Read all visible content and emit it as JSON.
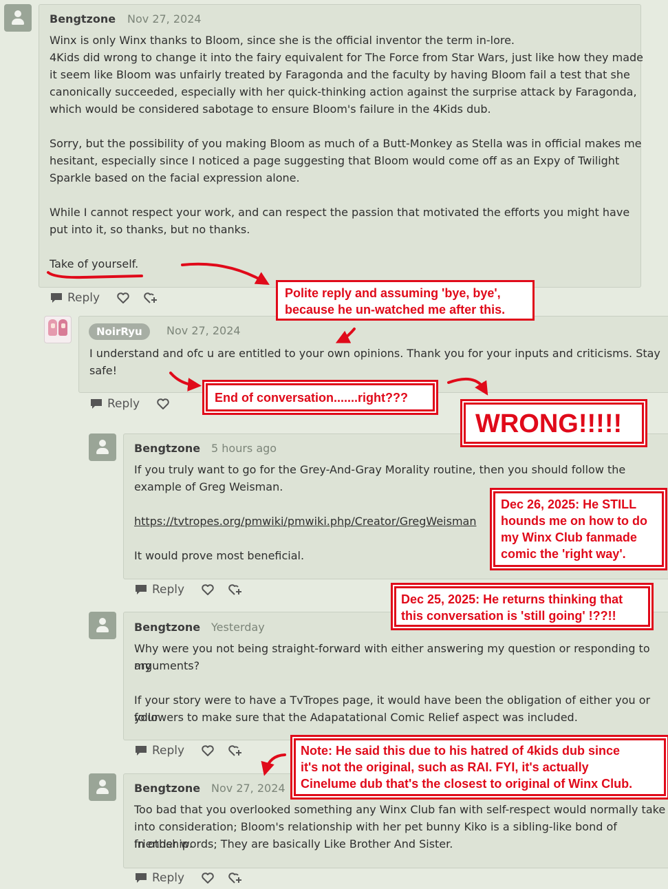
{
  "comments": [
    {
      "author": "Bengtzone",
      "date": "Nov 27, 2024",
      "lines": [
        "Winx is only Winx thanks to Bloom, since she is the official inventor the term in-lore.",
        "4Kids did wrong to change it into the fairy equivalent for The Force from Star Wars, just like how they made",
        "it seem like Bloom was unfairly treated by Faragonda and the faculty by having Bloom fail a test that she",
        "canonically succeeded,  especially with her quick-thinking action against the surprise attack by Faragonda,",
        "which would be considered sabotage to ensure Bloom's failure in the 4Kids dub.",
        "Sorry, but the possibility of you making Bloom as much of a Butt-Monkey as Stella was in official makes me",
        "hesitant, especially since I noticed a page suggesting that Bloom would come off as an Expy of Twilight",
        "Sparkle based on the facial expression alone.",
        "While I cannot respect your work, and can respect the passion that motivated the efforts you might have",
        "put into it, so thanks, but no thanks.",
        "Take of yourself."
      ],
      "reply_label": "Reply"
    },
    {
      "author": "NoirRyu",
      "date": "Nov 27, 2024",
      "lines": [
        "I understand and ofc u are entitled to your own opinions. Thank you for your inputs and criticisms. Stay",
        "safe!"
      ],
      "reply_label": "Reply"
    },
    {
      "author": "Bengtzone",
      "date": "5 hours ago",
      "lines": [
        "If you truly want to go for the Grey-And-Gray Morality routine, then you should follow the",
        "example of Greg Weisman.",
        "https://tvtropes.org/pmwiki/pmwiki.php/Creator/GregWeisman",
        "It would prove most beneficial."
      ],
      "reply_label": "Reply"
    },
    {
      "author": "Bengtzone",
      "date": "Yesterday",
      "lines": [
        "Why were you not being straight-forward with either answering my question or responding to my",
        "arguments?",
        "If your story were to have a TvTropes page, it would have been the obligation of either you or your",
        "followers to make sure that the Adapatational Comic Relief aspect was included."
      ],
      "reply_label": "Reply"
    },
    {
      "author": "Bengtzone",
      "date": "Nov 27, 2024",
      "lines": [
        "Too bad that you overlooked something any Winx Club fan with self-respect would normally take",
        "into consideration; Bloom's relationship with her pet bunny Kiko is a sibling-like bond of friendship.",
        "In other words; They are basically Like Brother And Sister."
      ],
      "reply_label": "Reply"
    }
  ],
  "annotations": {
    "polite": [
      "Polite reply and assuming 'bye, bye',",
      "because he un-watched me after this."
    ],
    "end": "End of conversation.......right???",
    "wrong": "WRONG!!!!!",
    "dec26": [
      "Dec 26, 2025: He STILL",
      "hounds me on how to do",
      "my Winx Club fanmade",
      "comic the 'right way'."
    ],
    "dec25": [
      "Dec 25, 2025: He returns thinking that",
      "this conversation is 'still going' !??!!"
    ],
    "note": [
      "Note: He said this due to his hatred of 4kids dub since",
      "it's not the original, such as RAI. FYI, it's actually",
      "Cinelume dub that's the closest to original of Winx Club."
    ]
  },
  "icons": {
    "reply": "speech-bubble-icon",
    "like": "heart-icon",
    "react": "heart-plus-icon",
    "avatar": "user-silhouette-icon"
  },
  "colors": {
    "annotation_red": "#e00a1a",
    "card_bg": "#dde3d6",
    "page_bg": "#e6ebe0"
  }
}
